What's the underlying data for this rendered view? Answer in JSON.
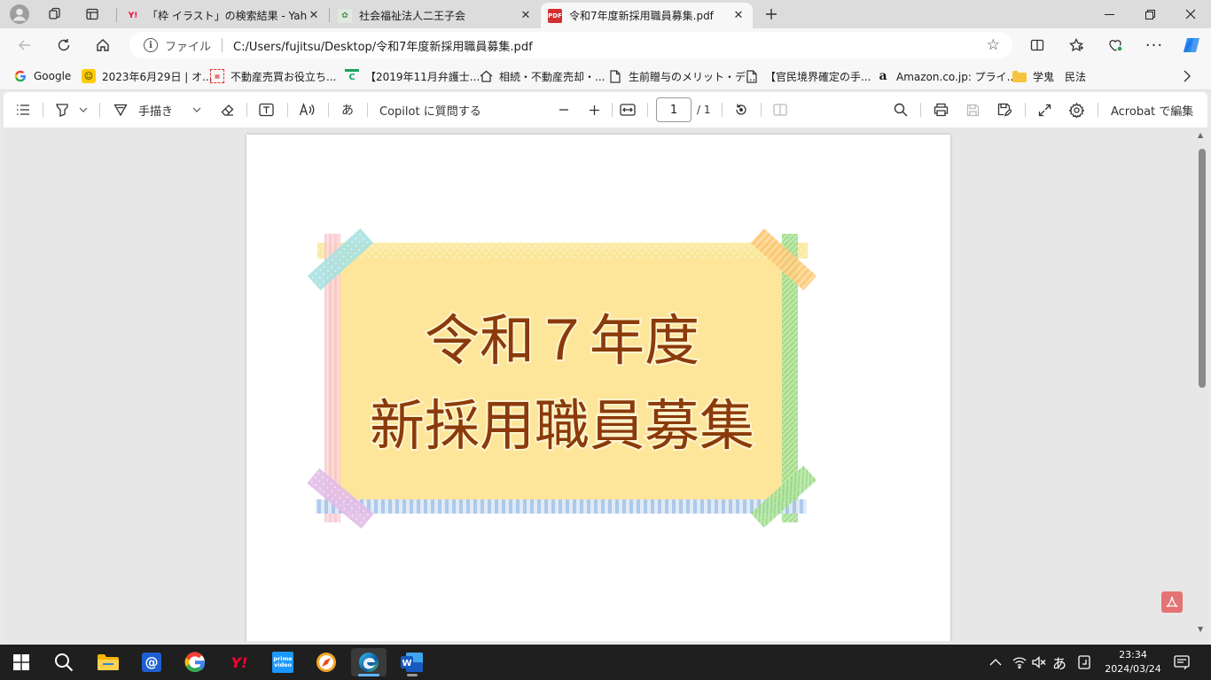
{
  "browser": {
    "tabs": [
      {
        "title": "「枠 イラスト」の検索結果 - Yahoo!検",
        "favicon": "Y!",
        "active": false
      },
      {
        "title": "社会福祉法人二王子会",
        "favicon": "leaf",
        "active": false
      },
      {
        "title": "令和7年度新採用職員募集.pdf",
        "favicon": "PDF",
        "active": true
      }
    ],
    "address": {
      "scheme_label": "ファイル",
      "url": "C:/Users/fujitsu/Desktop/令和7年度新採用職員募集.pdf"
    },
    "favorites": [
      {
        "label": "Google",
        "icon": "google-icon"
      },
      {
        "label": "2023年6月29日 | オ...",
        "icon": "smiley-icon"
      },
      {
        "label": "不動産売買お役立ち...",
        "icon": "realestate-icon"
      },
      {
        "label": "【2019年11月弁護士...",
        "icon": "c-icon"
      },
      {
        "label": "相続・不動産売却・...",
        "icon": "house-icon"
      },
      {
        "label": "生前贈与のメリット・デ...",
        "icon": "page-icon"
      },
      {
        "label": "【官民境界確定の手...",
        "icon": "page-icon"
      },
      {
        "label": "Amazon.co.jp: プライ...",
        "icon": "amazon-icon"
      },
      {
        "label": "学鬼　民法",
        "icon": "folder-icon"
      }
    ]
  },
  "pdf_toolbar": {
    "draw_label": "手描き",
    "copilot_label": "Copilot に質問する",
    "page_current": "1",
    "page_total": "/ 1",
    "acrobat_label": "Acrobat で編集"
  },
  "document": {
    "line1": "令和７年度",
    "line2": "新採用職員募集",
    "frame_color": "#fde69a",
    "text_color": "#8b3a0a"
  },
  "taskbar": {
    "time": "23:34",
    "date": "2024/03/24",
    "ime": "あ"
  },
  "colors": {
    "accent": "#0078d4",
    "tab_strip": "#dcdcdc"
  }
}
